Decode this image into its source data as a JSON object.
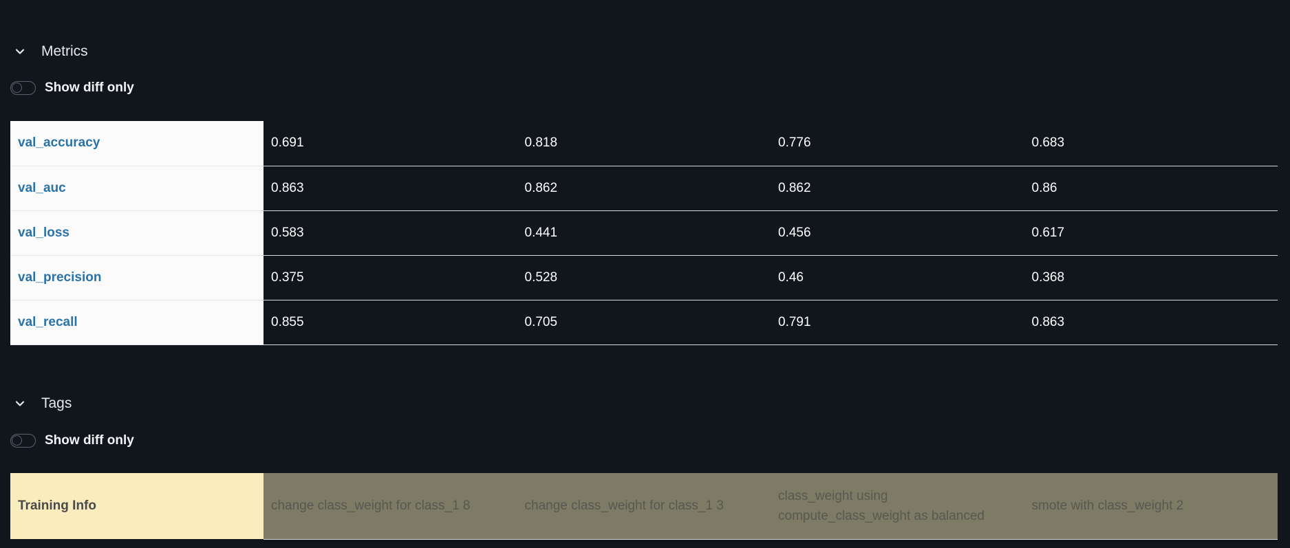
{
  "metrics": {
    "title": "Metrics",
    "toggle_label": "Show diff only",
    "rows": [
      {
        "name": "val_accuracy",
        "values": [
          "0.691",
          "0.818",
          "0.776",
          "0.683"
        ]
      },
      {
        "name": "val_auc",
        "values": [
          "0.863",
          "0.862",
          "0.862",
          "0.86"
        ]
      },
      {
        "name": "val_loss",
        "values": [
          "0.583",
          "0.441",
          "0.456",
          "0.617"
        ]
      },
      {
        "name": "val_precision",
        "values": [
          "0.375",
          "0.528",
          "0.46",
          "0.368"
        ]
      },
      {
        "name": "val_recall",
        "values": [
          "0.855",
          "0.705",
          "0.791",
          "0.863"
        ]
      }
    ]
  },
  "tags": {
    "title": "Tags",
    "toggle_label": "Show diff only",
    "rows": [
      {
        "name": "Training Info",
        "values": [
          "change class_weight for class_1 8",
          "change class_weight for class_1 3",
          "class_weight using compute_class_weight as balanced",
          "smote with class_weight 2"
        ]
      }
    ]
  },
  "icons": {
    "collapse": "chevron-down-icon"
  },
  "colors": {
    "background": "#11161d",
    "metric_name": "#2a73a8",
    "tag_name_bg": "#f9edbe",
    "tag_value_bg": "#7d7a66"
  }
}
